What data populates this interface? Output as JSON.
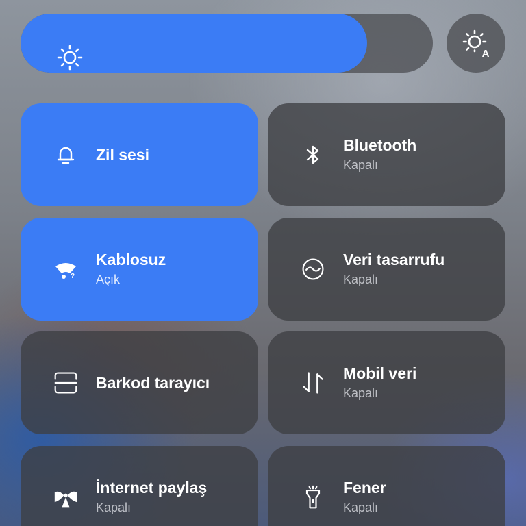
{
  "brightness": {
    "level_percent": 84,
    "icon": "sun-icon",
    "auto_icon": "auto-brightness-icon",
    "auto_badge": "A",
    "active_color": "#3b7cf5"
  },
  "tiles": [
    {
      "id": "ringtone",
      "label": "Zil sesi",
      "status": "",
      "active": true,
      "icon": "bell-icon"
    },
    {
      "id": "bluetooth",
      "label": "Bluetooth",
      "status": "Kapalı",
      "active": false,
      "icon": "bluetooth-icon"
    },
    {
      "id": "wifi",
      "label": "Kablosuz",
      "status": "Açık",
      "active": true,
      "icon": "wifi-icon"
    },
    {
      "id": "data-saver",
      "label": "Veri tasarrufu",
      "status": "Kapalı",
      "active": false,
      "icon": "data-saver-icon"
    },
    {
      "id": "barcode",
      "label": "Barkod tarayıcı",
      "status": "",
      "active": false,
      "icon": "scanner-icon"
    },
    {
      "id": "mobile-data",
      "label": "Mobil veri",
      "status": "Kapalı",
      "active": false,
      "icon": "mobile-data-icon"
    },
    {
      "id": "hotspot",
      "label": "İnternet paylaş",
      "status": "Kapalı",
      "active": false,
      "icon": "hotspot-icon"
    },
    {
      "id": "flashlight",
      "label": "Fener",
      "status": "Kapalı",
      "active": false,
      "icon": "flashlight-icon"
    }
  ]
}
